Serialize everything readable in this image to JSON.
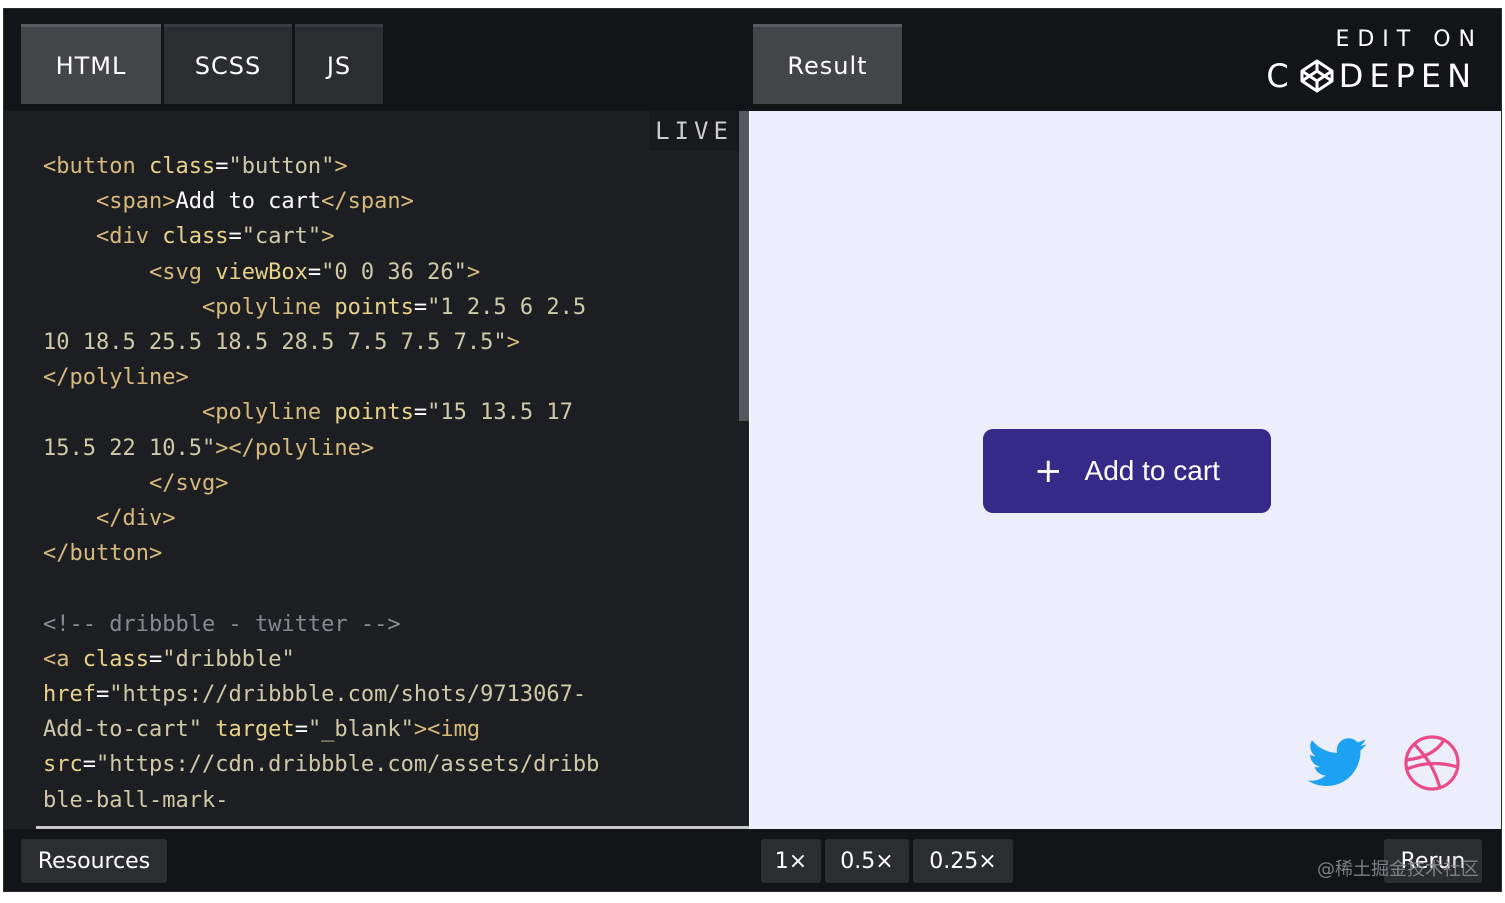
{
  "tabs": {
    "html": "HTML",
    "scss": "SCSS",
    "js": "JS",
    "result": "Result"
  },
  "brand": {
    "edit_on": "EDIT ON",
    "codepen_left": "C",
    "codepen_right": "DEPEN"
  },
  "editor": {
    "live_label": "LIVE",
    "code": {
      "l1_tag_open": "<button ",
      "l1_attr": "class",
      "l1_eq": "=",
      "l1_val": "\"button\"",
      "l1_close": ">",
      "l2_tag_open": "<span>",
      "l2_text": "Add to cart",
      "l2_tag_close": "</span>",
      "l3_tag_open": "<div ",
      "l3_attr": "class",
      "l3_val": "\"cart\"",
      "l3_close": ">",
      "l4_tag_open": "<svg ",
      "l4_attr": "viewBox",
      "l4_val": "\"0 0 36 26\"",
      "l4_close": ">",
      "l5_tag_open": "<polyline ",
      "l5_attr": "points",
      "l5_val_a": "\"1 2.5 6 2.5",
      "l6_val_b": "10 18.5 25.5 18.5 28.5 7.5 7.5 7.5\"",
      "l6_close": ">",
      "l7_tag": "</polyline>",
      "l8_tag_open": "<polyline ",
      "l8_attr": "points",
      "l8_val_a": "\"15 13.5 17",
      "l9_val_b": "15.5 22 10.5\"",
      "l9_close": "></polyline>",
      "l10_tag": "</svg>",
      "l11_tag": "</div>",
      "l12_tag": "</button>",
      "l14_comment": "<!-- dribbble - twitter -->",
      "l15_tag_open": "<a ",
      "l15_attr": "class",
      "l15_val": "\"dribbble\"",
      "l16_attr": "href",
      "l16_val": "\"https://dribbble.com/shots/9713067-",
      "l17_val": "Add-to-cart\"",
      "l17_attr": "target",
      "l17_val2": "\"_blank\"",
      "l17_close": "><img",
      "l18_attr": "src",
      "l18_val": "\"https://cdn.dribbble.com/assets/dribb",
      "l19_val": "ble-ball-mark-"
    }
  },
  "result": {
    "button_label": "Add to cart",
    "plus_symbol": "+",
    "button_color": "#362a89",
    "background_color": "#edeefb",
    "twitter_color": "#1da1f2",
    "dribbble_color": "#ea4c89"
  },
  "bottom": {
    "resources": "Resources",
    "zoom_1": "1×",
    "zoom_05": "0.5×",
    "zoom_025": "0.25×",
    "rerun": "Rerun",
    "watermark": "@稀土掘金技术社区"
  }
}
